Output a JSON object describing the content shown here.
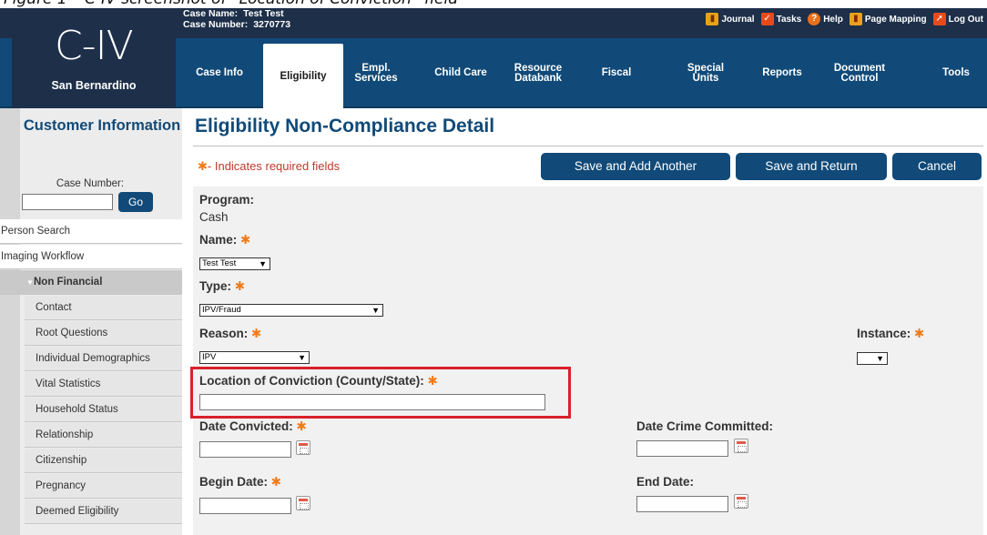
{
  "caption": "Figure 1 – C-IV screenshot of “Location of Conviction” field",
  "header": {
    "logo": "C-IV",
    "county": "San Bernardino",
    "case_name_label": "Case Name:",
    "case_name_value": "Test Test",
    "case_number_label": "Case Number:",
    "case_number_value": "3270773",
    "links": [
      {
        "label": "Journal",
        "icon": "book-icon"
      },
      {
        "label": "Tasks",
        "icon": "checkbox-icon"
      },
      {
        "label": "Help",
        "icon": "help-icon"
      },
      {
        "label": "Page Mapping",
        "icon": "book-icon"
      },
      {
        "label": "Log Out",
        "icon": "logout-icon"
      }
    ]
  },
  "nav": {
    "tabs": [
      {
        "label": "Case Info"
      },
      {
        "label": "Eligibility",
        "active": true
      },
      {
        "label": "Empl.\nServices"
      },
      {
        "label": "Child Care"
      },
      {
        "label": "Resource\nDatabank"
      },
      {
        "label": "Fiscal"
      },
      {
        "label": "Special\nUnits"
      },
      {
        "label": "Reports"
      },
      {
        "label": "Document\nControl"
      },
      {
        "label": "Tools"
      }
    ]
  },
  "sidebar": {
    "title": "Customer Information",
    "case_number_label": "Case Number:",
    "go_label": "Go",
    "top_items": [
      "Person Search",
      "Imaging Workflow"
    ],
    "group_label": "Non Financial",
    "sub_items": [
      "Contact",
      "Root Questions",
      "Individual Demographics",
      "Vital Statistics",
      "Household Status",
      "Relationship",
      "Citizenship",
      "Pregnancy",
      "Deemed Eligibility"
    ]
  },
  "main": {
    "title": "Eligibility Non-Compliance Detail",
    "required_note": "- Indicates required fields",
    "buttons": {
      "save_add": "Save and Add Another",
      "save_return": "Save and Return",
      "cancel": "Cancel"
    },
    "form": {
      "program_label": "Program:",
      "program_value": "Cash",
      "name_label": "Name:",
      "name_value": "Test Test",
      "type_label": "Type:",
      "type_value": "IPV/Fraud",
      "reason_label": "Reason:",
      "reason_value": "IPV",
      "instance_label": "Instance:",
      "instance_value": "",
      "location_label": "Location of Conviction (County/State):",
      "location_value": "",
      "date_convicted_label": "Date Convicted:",
      "date_crime_label": "Date Crime Committed:",
      "begin_date_label": "Begin Date:",
      "end_date_label": "End Date:"
    }
  },
  "colors": {
    "header_bg": "#1d2f49",
    "nav_bg": "#114a78",
    "title": "#114a78",
    "required_star": "#f07a1a",
    "highlight": "#d9202a"
  }
}
